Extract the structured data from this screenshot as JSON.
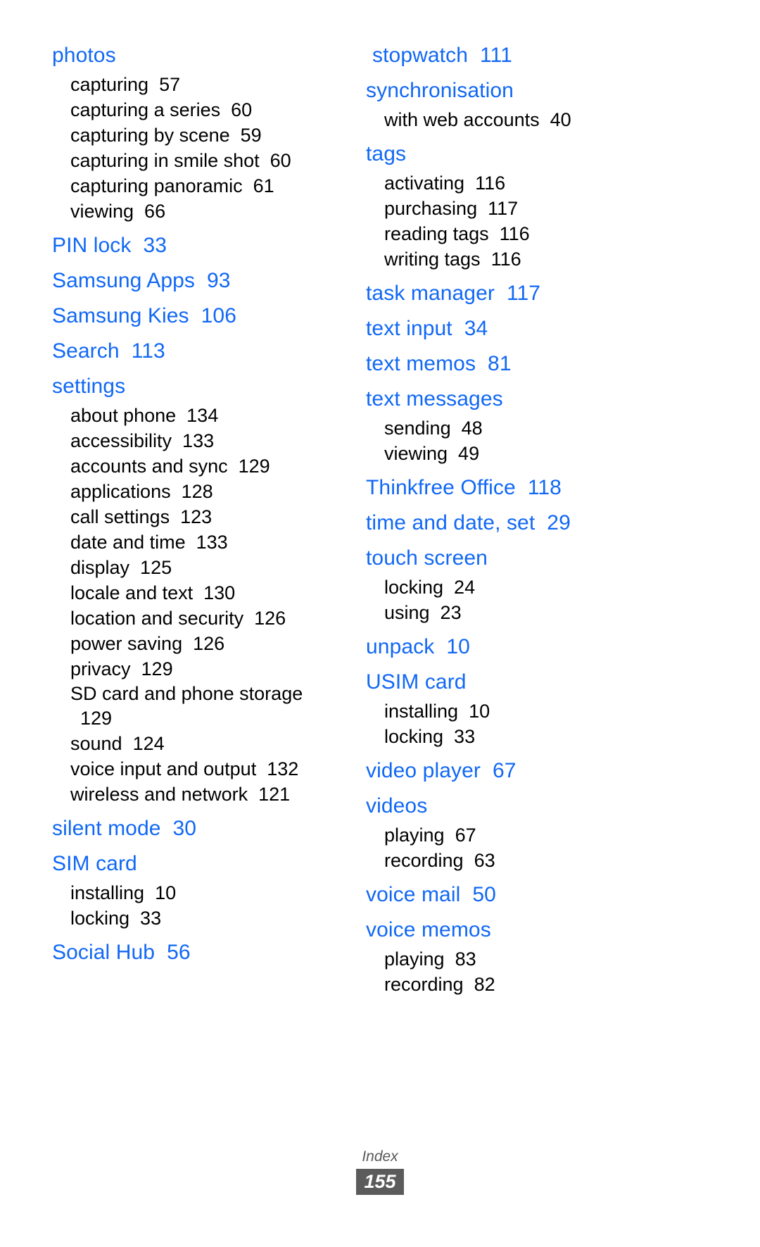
{
  "footer": {
    "section_label": "Index",
    "page_number": "155"
  },
  "colors": {
    "heading_blue": "#1168f5",
    "body_black": "#000000",
    "footer_gray": "#585858",
    "badge_background": "#5b5b5b",
    "badge_text": "#ffffff",
    "page_background": "#ffffff"
  },
  "columns": [
    {
      "id": "left",
      "groups": [
        {
          "heading": "photos",
          "page": "",
          "subs": [
            {
              "label": "capturing",
              "page": "57"
            },
            {
              "label": "capturing a series",
              "page": "60"
            },
            {
              "label": "capturing by scene",
              "page": "59"
            },
            {
              "label": "capturing in smile shot",
              "page": "60"
            },
            {
              "label": "capturing panoramic",
              "page": "61"
            },
            {
              "label": "viewing",
              "page": "66"
            }
          ]
        },
        {
          "heading": "PIN lock",
          "page": "33",
          "subs": []
        },
        {
          "heading": "Samsung Apps",
          "page": "93",
          "subs": []
        },
        {
          "heading": "Samsung Kies",
          "page": "106",
          "subs": []
        },
        {
          "heading": "Search",
          "page": "113",
          "subs": []
        },
        {
          "heading": "settings",
          "page": "",
          "subs": [
            {
              "label": "about phone",
              "page": "134"
            },
            {
              "label": "accessibility",
              "page": "133"
            },
            {
              "label": "accounts and sync",
              "page": "129"
            },
            {
              "label": "applications",
              "page": "128"
            },
            {
              "label": "call settings",
              "page": "123"
            },
            {
              "label": "date and time",
              "page": "133"
            },
            {
              "label": "display",
              "page": "125"
            },
            {
              "label": "locale and text",
              "page": "130"
            },
            {
              "label": "location and security",
              "page": "126"
            },
            {
              "label": "power saving",
              "page": "126"
            },
            {
              "label": "privacy",
              "page": "129"
            },
            {
              "label": "SD card and phone storage",
              "page": "129",
              "wrap": true
            },
            {
              "label": "sound",
              "page": "124"
            },
            {
              "label": "voice input and output",
              "page": "132"
            },
            {
              "label": "wireless and network",
              "page": "121"
            }
          ]
        },
        {
          "heading": "silent mode",
          "page": "30",
          "subs": []
        },
        {
          "heading": "SIM card",
          "page": "",
          "subs": [
            {
              "label": "installing",
              "page": "10"
            },
            {
              "label": "locking",
              "page": "33"
            }
          ]
        },
        {
          "heading": "Social Hub",
          "page": "56",
          "subs": []
        }
      ]
    },
    {
      "id": "right",
      "groups": [
        {
          "heading": "stopwatch",
          "page": "111",
          "subs": []
        },
        {
          "heading": "synchronisation",
          "page": "",
          "subs": [
            {
              "label": "with web accounts",
              "page": "40"
            }
          ]
        },
        {
          "heading": "tags",
          "page": "",
          "subs": [
            {
              "label": "activating",
              "page": "116"
            },
            {
              "label": "purchasing",
              "page": "117"
            },
            {
              "label": "reading tags",
              "page": "116"
            },
            {
              "label": "writing tags",
              "page": "116"
            }
          ]
        },
        {
          "heading": "task manager",
          "page": "117",
          "subs": []
        },
        {
          "heading": "text input",
          "page": "34",
          "subs": []
        },
        {
          "heading": "text memos",
          "page": "81",
          "subs": []
        },
        {
          "heading": "text messages",
          "page": "",
          "subs": [
            {
              "label": "sending",
              "page": "48"
            },
            {
              "label": "viewing",
              "page": "49"
            }
          ]
        },
        {
          "heading": "Thinkfree Office",
          "page": "118",
          "subs": []
        },
        {
          "heading": "time and date, set",
          "page": "29",
          "subs": []
        },
        {
          "heading": "touch screen",
          "page": "",
          "subs": [
            {
              "label": "locking",
              "page": "24"
            },
            {
              "label": "using",
              "page": "23"
            }
          ]
        },
        {
          "heading": "unpack",
          "page": "10",
          "subs": []
        },
        {
          "heading": "USIM card",
          "page": "",
          "subs": [
            {
              "label": "installing",
              "page": "10"
            },
            {
              "label": "locking",
              "page": "33"
            }
          ]
        },
        {
          "heading": "video player",
          "page": "67",
          "subs": []
        },
        {
          "heading": "videos",
          "page": "",
          "subs": [
            {
              "label": "playing",
              "page": "67"
            },
            {
              "label": "recording",
              "page": "63"
            }
          ]
        },
        {
          "heading": "voice mail",
          "page": "50",
          "subs": []
        },
        {
          "heading": "voice memos",
          "page": "",
          "subs": [
            {
              "label": "playing",
              "page": "83"
            },
            {
              "label": "recording",
              "page": "82"
            }
          ]
        }
      ]
    }
  ]
}
